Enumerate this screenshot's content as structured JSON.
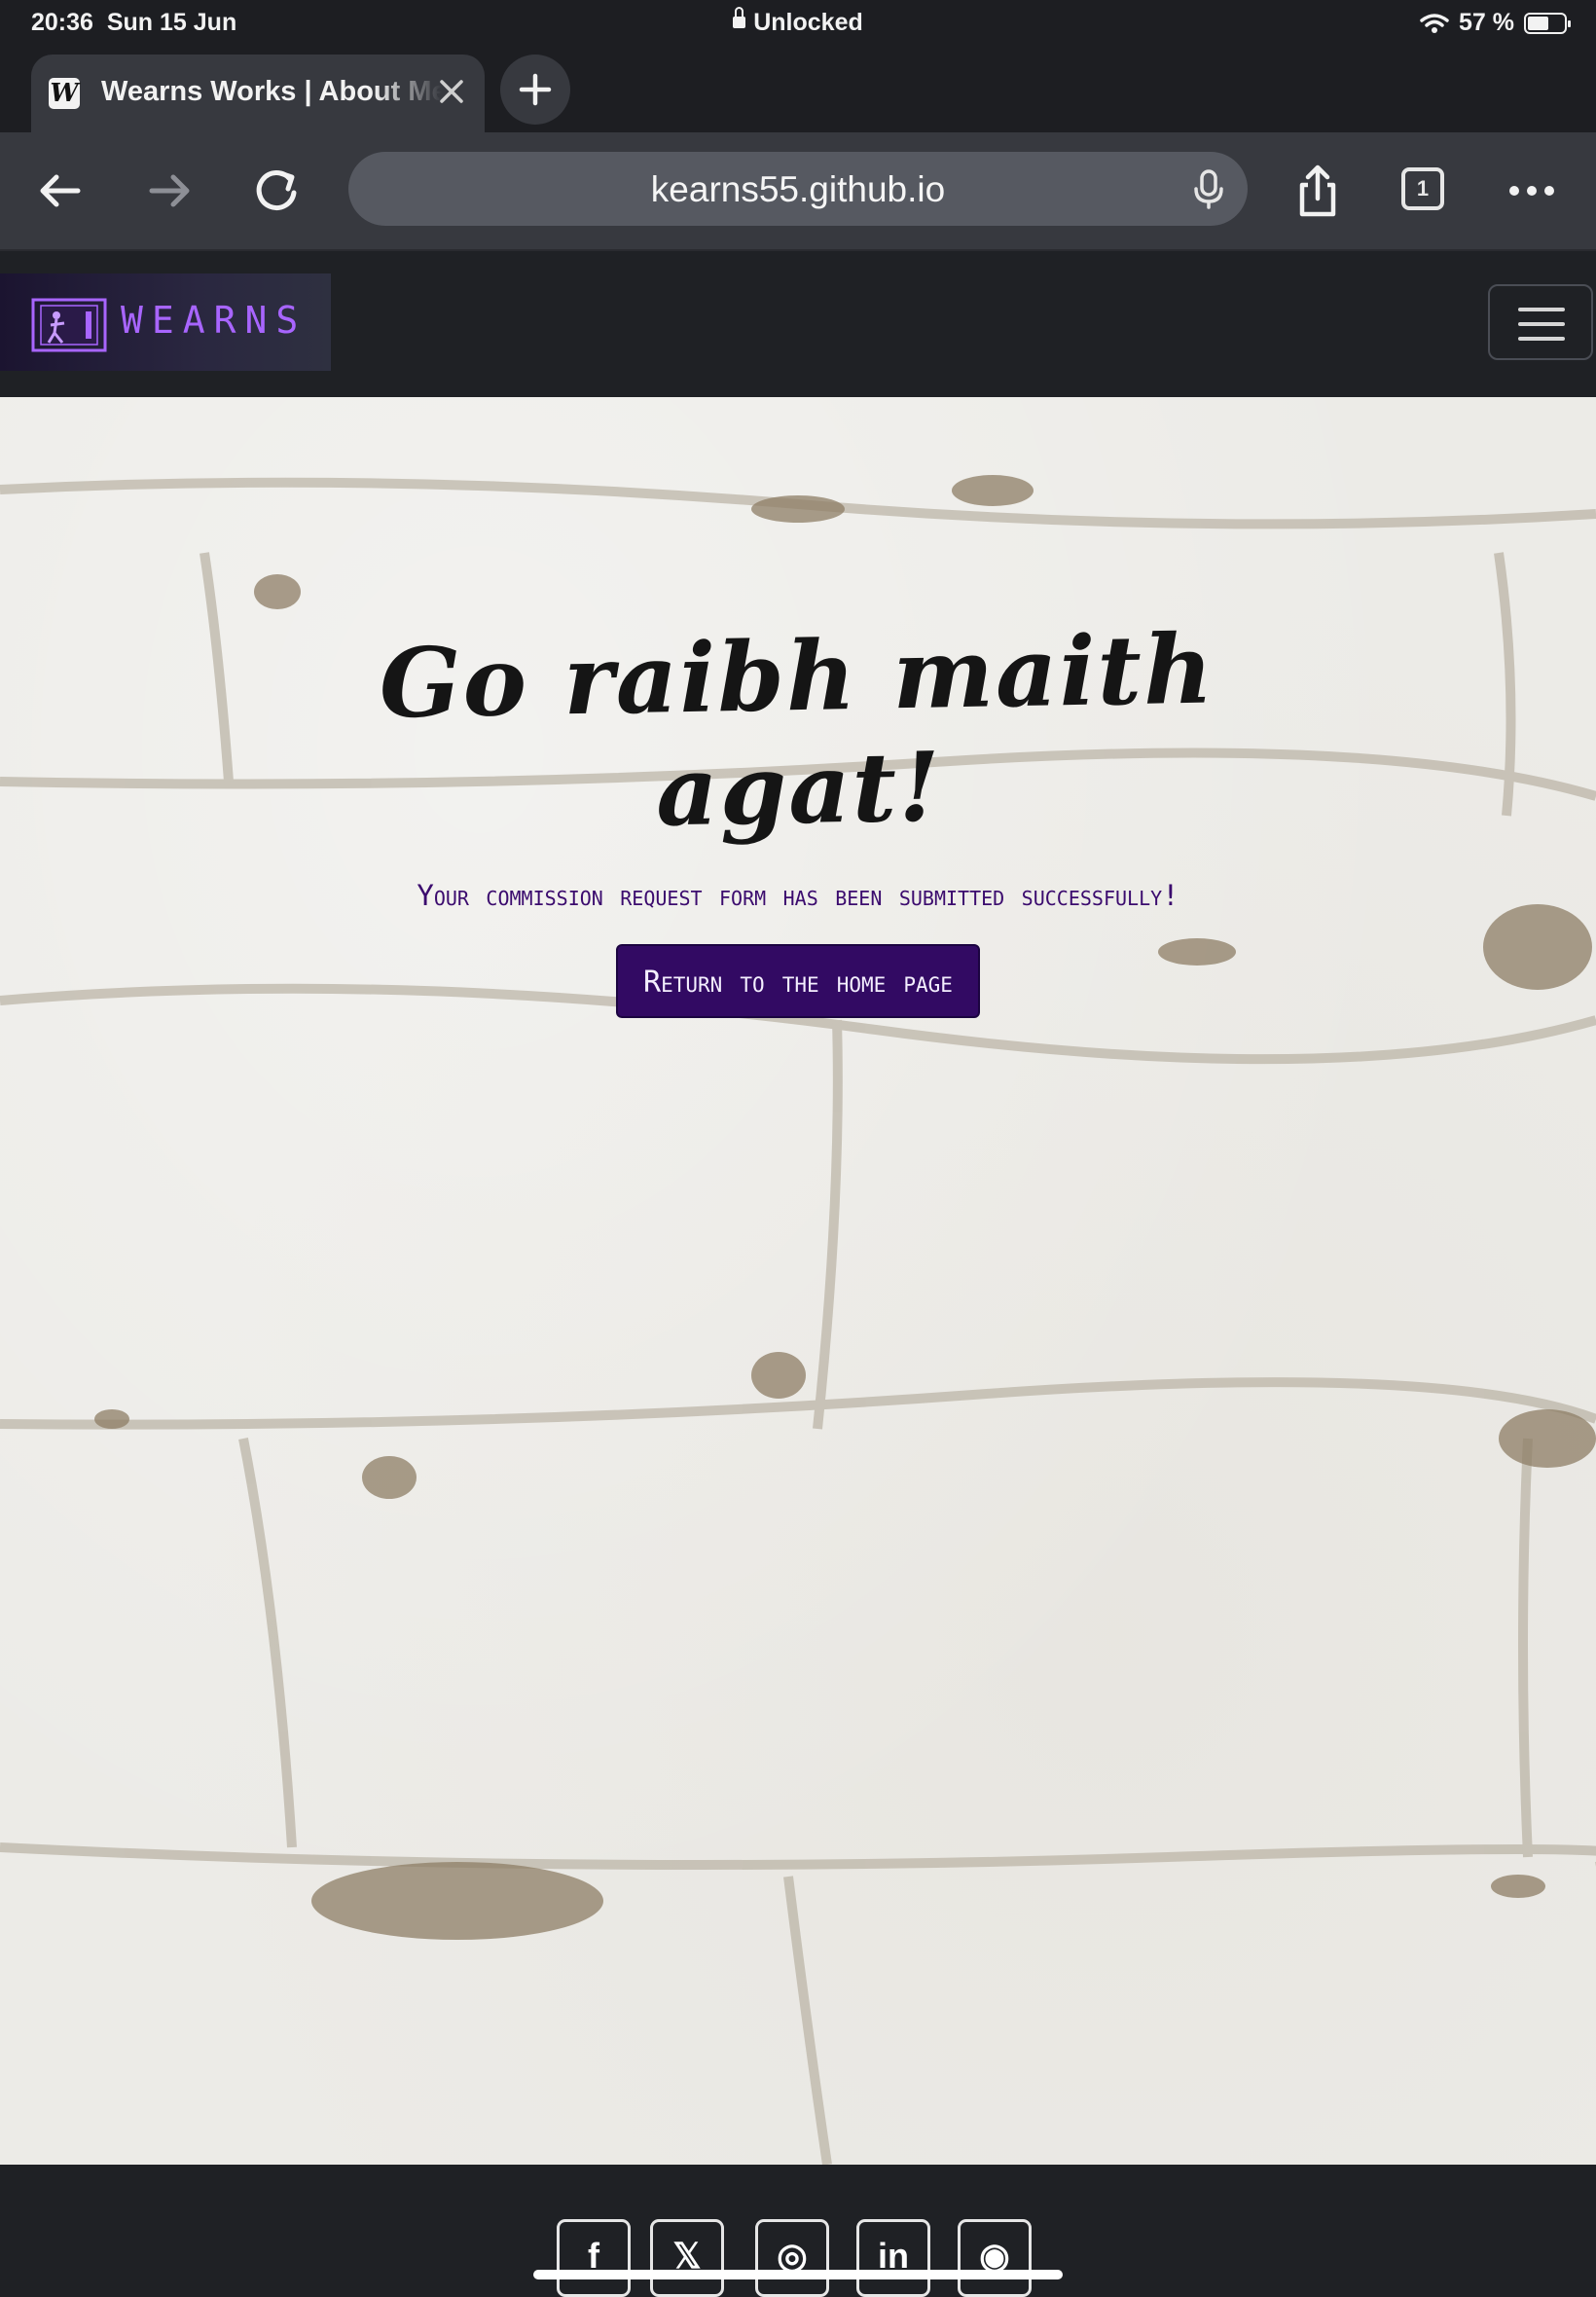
{
  "status_bar": {
    "time": "20:36",
    "date": "Sun 15 Jun",
    "lock_status": "Unlocked",
    "battery": "57 %",
    "battery_level": 0.57
  },
  "browser": {
    "tab_title": "Wearns Works | About Me",
    "favicon_letter": "W",
    "url": "kearns55.github.io",
    "tab_count": "1"
  },
  "site": {
    "brand_name": "WEARNS",
    "accent_color": "#a865ff",
    "button_color": "#320a63"
  },
  "hero": {
    "headline": "Go raibh maith agat!",
    "message": "Your commission request form has been submitted successfully!",
    "button_label": "Return to the home page"
  },
  "footer": {
    "social": [
      {
        "name": "facebook-icon",
        "glyph": "f"
      },
      {
        "name": "x-icon",
        "glyph": "𝕏"
      },
      {
        "name": "instagram-icon",
        "glyph": "◎"
      },
      {
        "name": "linkedin-icon",
        "glyph": "in"
      },
      {
        "name": "github-icon",
        "glyph": "◉"
      }
    ]
  }
}
